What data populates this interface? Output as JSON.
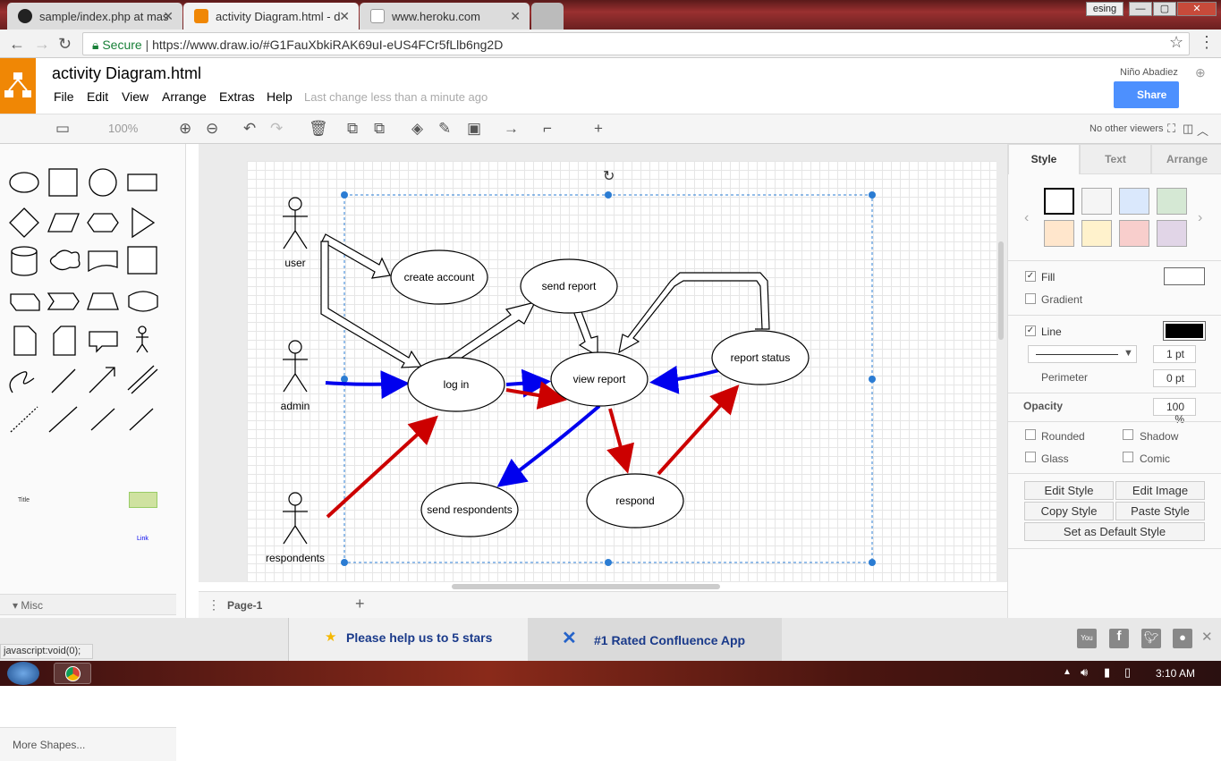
{
  "browser": {
    "tabs": [
      {
        "label": "sample/index.php at mas"
      },
      {
        "label": "activity Diagram.html - d"
      },
      {
        "label": "www.heroku.com"
      }
    ],
    "window_user": "esing",
    "secure_label": "Secure",
    "url": "https://www.draw.io/#G1FauXbkiRAK69uI-eUS4FCr5fLlb6ng2D",
    "status_url": "javascript:void(0);"
  },
  "app": {
    "title": "activity Diagram.html",
    "menu": [
      "File",
      "Edit",
      "View",
      "Arrange",
      "Extras",
      "Help"
    ],
    "last_change": "Last change less than a minute ago",
    "user_name": "Niño Abadiez",
    "share_label": "Share",
    "viewers": "No other viewers"
  },
  "toolbar": {
    "zoom": "100%"
  },
  "sidebar": {
    "section_misc": "Misc",
    "more_shapes": "More Shapes...",
    "misc_items": [
      "Title",
      "Link"
    ]
  },
  "diagram": {
    "actors": [
      "user",
      "admin",
      "respondents"
    ],
    "nodes": [
      "create account",
      "send report",
      "log in",
      "view report",
      "report status",
      "send respondents",
      "respond"
    ]
  },
  "pages": {
    "current": "Page-1"
  },
  "format": {
    "tabs": [
      "Style",
      "Text",
      "Arrange"
    ],
    "fill": "Fill",
    "gradient": "Gradient",
    "line": "Line",
    "line_width": "1 pt",
    "perimeter": "Perimeter",
    "perimeter_value": "0 pt",
    "opacity": "Opacity",
    "opacity_value": "100 %",
    "rounded": "Rounded",
    "shadow": "Shadow",
    "glass": "Glass",
    "comic": "Comic",
    "buttons": [
      "Edit Style",
      "Edit Image",
      "Copy Style",
      "Paste Style",
      "Set as Default Style"
    ],
    "swatches": [
      "#ffffff",
      "#f5f5f5",
      "#dae8fc",
      "#d5e8d4",
      "#ffe6cc",
      "#fff2cc",
      "#f8cecc",
      "#e1d5e7"
    ]
  },
  "banner": {
    "stars": "Please help us to 5 stars",
    "confluence": "#1 Rated Confluence App"
  },
  "taskbar": {
    "time": "3:10 AM"
  }
}
